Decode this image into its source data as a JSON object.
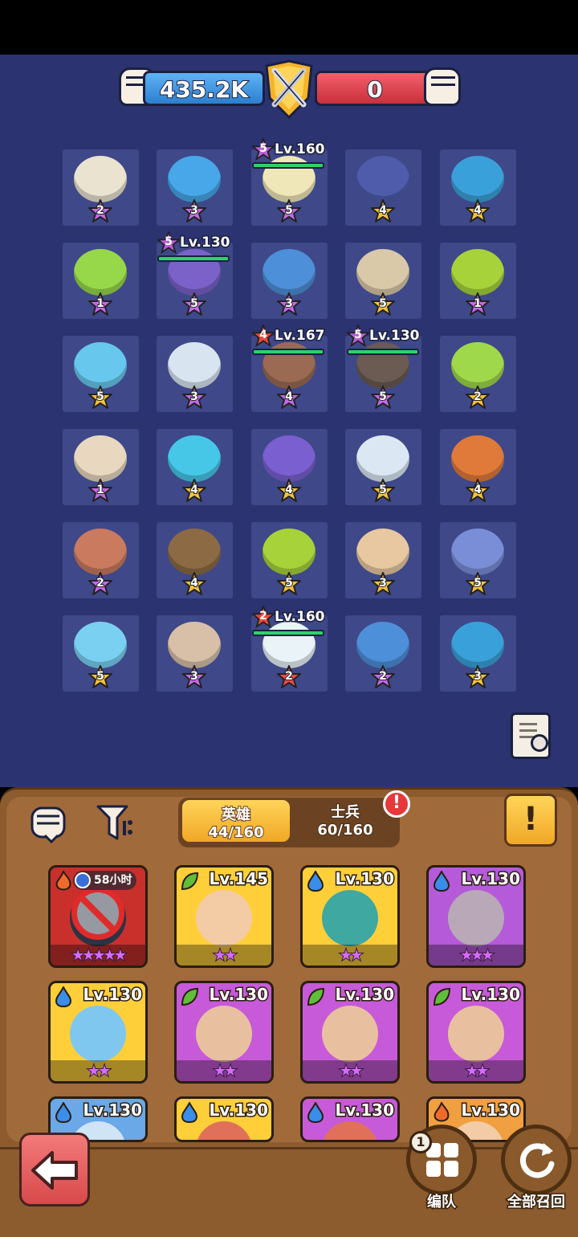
{
  "power": {
    "left_value": "435.2K",
    "right_value": "0"
  },
  "field": {
    "tiles": [
      {
        "star": "2",
        "color": "#e9e3d0",
        "tier": "purple"
      },
      {
        "star": "3",
        "color": "#47a7e8",
        "tier": "purple"
      },
      {
        "star": "5",
        "color": "#f0e7b8",
        "tier": "purple"
      },
      {
        "star": "4",
        "color": "#4e5cab",
        "tier": "gold"
      },
      {
        "star": "4",
        "color": "#3aa0d9",
        "tier": "gold"
      },
      {
        "star": "1",
        "color": "#96d84a",
        "tier": "purple"
      },
      {
        "star": "5",
        "color": "#7a62c8",
        "tier": "purple"
      },
      {
        "star": "3",
        "color": "#4d8fd8",
        "tier": "purple"
      },
      {
        "star": "5",
        "color": "#d9c9a8",
        "tier": "gold"
      },
      {
        "star": "1",
        "color": "#a7d23a",
        "tier": "purple"
      },
      {
        "star": "5",
        "color": "#68c7ec",
        "tier": "gold"
      },
      {
        "star": "3",
        "color": "#d8e4f0",
        "tier": "purple"
      },
      {
        "star": "4",
        "color": "#9a6b52",
        "tier": "purple"
      },
      {
        "star": "5",
        "color": "#6b5b52",
        "tier": "purple"
      },
      {
        "star": "2",
        "color": "#9fd84a",
        "tier": "gold"
      },
      {
        "star": "1",
        "color": "#e8d8c0",
        "tier": "purple"
      },
      {
        "star": "4",
        "color": "#47c7e8",
        "tier": "gold"
      },
      {
        "star": "4",
        "color": "#7a5fd0",
        "tier": "gold"
      },
      {
        "star": "5",
        "color": "#dbe8f4",
        "tier": "gold"
      },
      {
        "star": "4",
        "color": "#e07a3a",
        "tier": "gold"
      },
      {
        "star": "2",
        "color": "#c97a5f",
        "tier": "purple"
      },
      {
        "star": "4",
        "color": "#8c6a44",
        "tier": "gold"
      },
      {
        "star": "5",
        "color": "#a7d23a",
        "tier": "gold"
      },
      {
        "star": "3",
        "color": "#e8c8a0",
        "tier": "gold"
      },
      {
        "star": "5",
        "color": "#7a8ed8",
        "tier": "gold"
      },
      {
        "star": "5",
        "color": "#7ad0f0",
        "tier": "gold"
      },
      {
        "star": "3",
        "color": "#d8c0a8",
        "tier": "purple"
      },
      {
        "star": "2",
        "color": "#eaf3f8",
        "tier": "red"
      },
      {
        "star": "2",
        "color": "#4d8fd8",
        "tier": "purple"
      },
      {
        "star": "3",
        "color": "#3aa0d9",
        "tier": "gold"
      }
    ],
    "level_tags": [
      {
        "badge": "5",
        "text": "Lv.160",
        "color": "#b85fd8"
      },
      {
        "badge": "5",
        "text": "Lv.130",
        "color": "#b85fd8"
      },
      {
        "badge": "4",
        "text": "Lv.167",
        "color": "#e84a3a"
      },
      {
        "badge": "5",
        "text": "Lv.130",
        "color": "#b85fd8"
      },
      {
        "badge": "2",
        "text": "Lv.160",
        "color": "#e84a3a"
      }
    ]
  },
  "panel": {
    "tab_heroes": {
      "label": "英雄",
      "count": "44/160"
    },
    "tab_soldiers": {
      "label": "士兵",
      "count": "60/160"
    },
    "alert_mark": "!",
    "info_mark": "!",
    "cards": [
      {
        "element": "fire",
        "element_color": "#f06a2a",
        "bg": "#c9302c",
        "face": "#2c3344",
        "level": "",
        "timer": "58小时",
        "stars": "★★★★★",
        "banned": true
      },
      {
        "element": "leaf",
        "element_color": "#5fbf3a",
        "bg": "#ffcf3a",
        "face": "#f3cba5",
        "level": "Lv.145",
        "timer": "",
        "stars": "★★",
        "banned": false
      },
      {
        "element": "water",
        "element_color": "#3a8de8",
        "bg": "#ffcf3a",
        "face": "#3fa8a0",
        "level": "Lv.130",
        "timer": "",
        "stars": "★★",
        "banned": false
      },
      {
        "element": "water",
        "element_color": "#3a8de8",
        "bg": "#b55ad8",
        "face": "#b9a8b8",
        "level": "Lv.130",
        "timer": "",
        "stars": "★★★",
        "banned": false
      },
      {
        "element": "water",
        "element_color": "#3a8de8",
        "bg": "#ffcf3a",
        "face": "#7fc7ee",
        "level": "Lv.130",
        "timer": "",
        "stars": "★★",
        "banned": false
      },
      {
        "element": "leaf",
        "element_color": "#5fbf3a",
        "bg": "#c75ad8",
        "face": "#e8c0a0",
        "level": "Lv.130",
        "timer": "",
        "stars": "★★",
        "banned": false
      },
      {
        "element": "leaf",
        "element_color": "#5fbf3a",
        "bg": "#c75ad8",
        "face": "#e8c0a0",
        "level": "Lv.130",
        "timer": "",
        "stars": "★★",
        "banned": false
      },
      {
        "element": "leaf",
        "element_color": "#5fbf3a",
        "bg": "#c75ad8",
        "face": "#e8c0a0",
        "level": "Lv.130",
        "timer": "",
        "stars": "★★",
        "banned": false
      },
      {
        "element": "water",
        "element_color": "#3a8de8",
        "bg": "#6aa8e8",
        "face": "#cfe4f4",
        "level": "Lv.130",
        "timer": "",
        "stars": "",
        "banned": false
      },
      {
        "element": "water",
        "element_color": "#3a8de8",
        "bg": "#ffcf3a",
        "face": "#e0705a",
        "level": "Lv.130",
        "timer": "",
        "stars": "",
        "banned": false
      },
      {
        "element": "water",
        "element_color": "#3a8de8",
        "bg": "#c75ad8",
        "face": "#e0705a",
        "level": "Lv.130",
        "timer": "",
        "stars": "",
        "banned": false
      },
      {
        "element": "fire",
        "element_color": "#f06a2a",
        "bg": "#f0a040",
        "face": "#f3cba5",
        "level": "Lv.130",
        "timer": "",
        "stars": "",
        "banned": false
      }
    ]
  },
  "bottom": {
    "formation_label": "编队",
    "formation_badge": "1",
    "recall_label": "全部召回"
  },
  "colors": {
    "field_bg": "#2b3470",
    "panel_bg": "#8c5b2e",
    "accent_gold": "#f0a726"
  }
}
